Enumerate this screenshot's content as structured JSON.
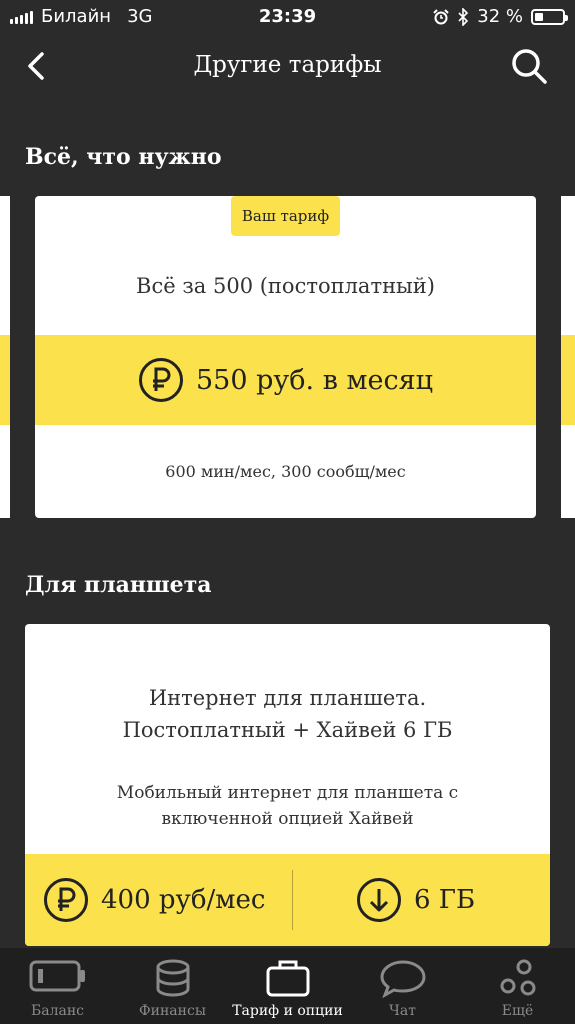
{
  "status_bar": {
    "carrier": "Билайн",
    "network": "3G",
    "time": "23:39",
    "battery": "32 %"
  },
  "nav": {
    "title": "Другие тарифы"
  },
  "sections": {
    "everything": {
      "title": "Всё, что нужно",
      "card": {
        "badge": "Ваш тариф",
        "name": "Всё за 500 (постоплатный)",
        "price": "550 руб. в месяц",
        "description": "600 мин/мес, 300 сообщ/мес"
      }
    },
    "tablet": {
      "title": "Для планшета",
      "card": {
        "name_line1": "Интернет для планшета.",
        "name_line2": "Постоплатный + Хайвей 6 ГБ",
        "desc_line1": "Мобильный интернет для планшета с",
        "desc_line2": "включенной опцией Хайвей",
        "price": "400 руб/мес",
        "data": "6 ГБ"
      }
    }
  },
  "tabbar": {
    "items": [
      {
        "label": "Баланс",
        "icon": "battery-icon",
        "active": false
      },
      {
        "label": "Финансы",
        "icon": "coins-icon",
        "active": false
      },
      {
        "label": "Тариф и опции",
        "icon": "briefcase-icon",
        "active": true
      },
      {
        "label": "Чат",
        "icon": "chat-bubble-icon",
        "active": false
      },
      {
        "label": "Ещё",
        "icon": "more-dots-icon",
        "active": false
      }
    ]
  },
  "colors": {
    "background": "#2b2b2b",
    "accent": "#fbe14c",
    "tabbar": "#1f1f1f"
  }
}
